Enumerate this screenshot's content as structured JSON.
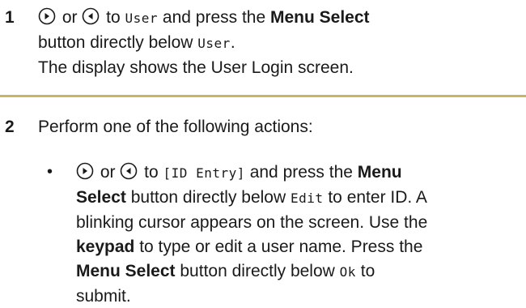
{
  "step1": {
    "number": "1",
    "or_text": " or ",
    "to_text": " to ",
    "lcd_user": "User",
    "and_press": " and press the ",
    "menu_select": "Menu Select",
    "button_below": "button directly below ",
    "lcd_user2": "User",
    "period": ".",
    "result": "The display shows the User Login screen."
  },
  "step2": {
    "number": "2",
    "intro": "Perform one of the following actions:",
    "bullet": {
      "symbol": "•",
      "or_text": " or ",
      "to_text": " to ",
      "lcd_id_entry": "[ID Entry]",
      "and_press": " and press the ",
      "menu_select_1a": "Menu",
      "menu_select_1b": "Select",
      "below_text": " button directly below ",
      "lcd_edit": "Edit",
      "enter_id": " to enter ID. A",
      "cursor_text": "blinking cursor appears on the screen. Use the",
      "keypad": "keypad",
      "keypad_rest": " to type or edit a user name. Press the",
      "menu_select_2": "Menu Select",
      "below_text_2": " button directly below ",
      "lcd_ok": "Ok",
      "to_text_2": " to",
      "submit": "submit."
    }
  },
  "colors": {
    "divider": "#c8b560",
    "text": "#1a1a1a"
  },
  "icons": [
    "right-arrow-circle-icon",
    "left-arrow-circle-icon"
  ]
}
